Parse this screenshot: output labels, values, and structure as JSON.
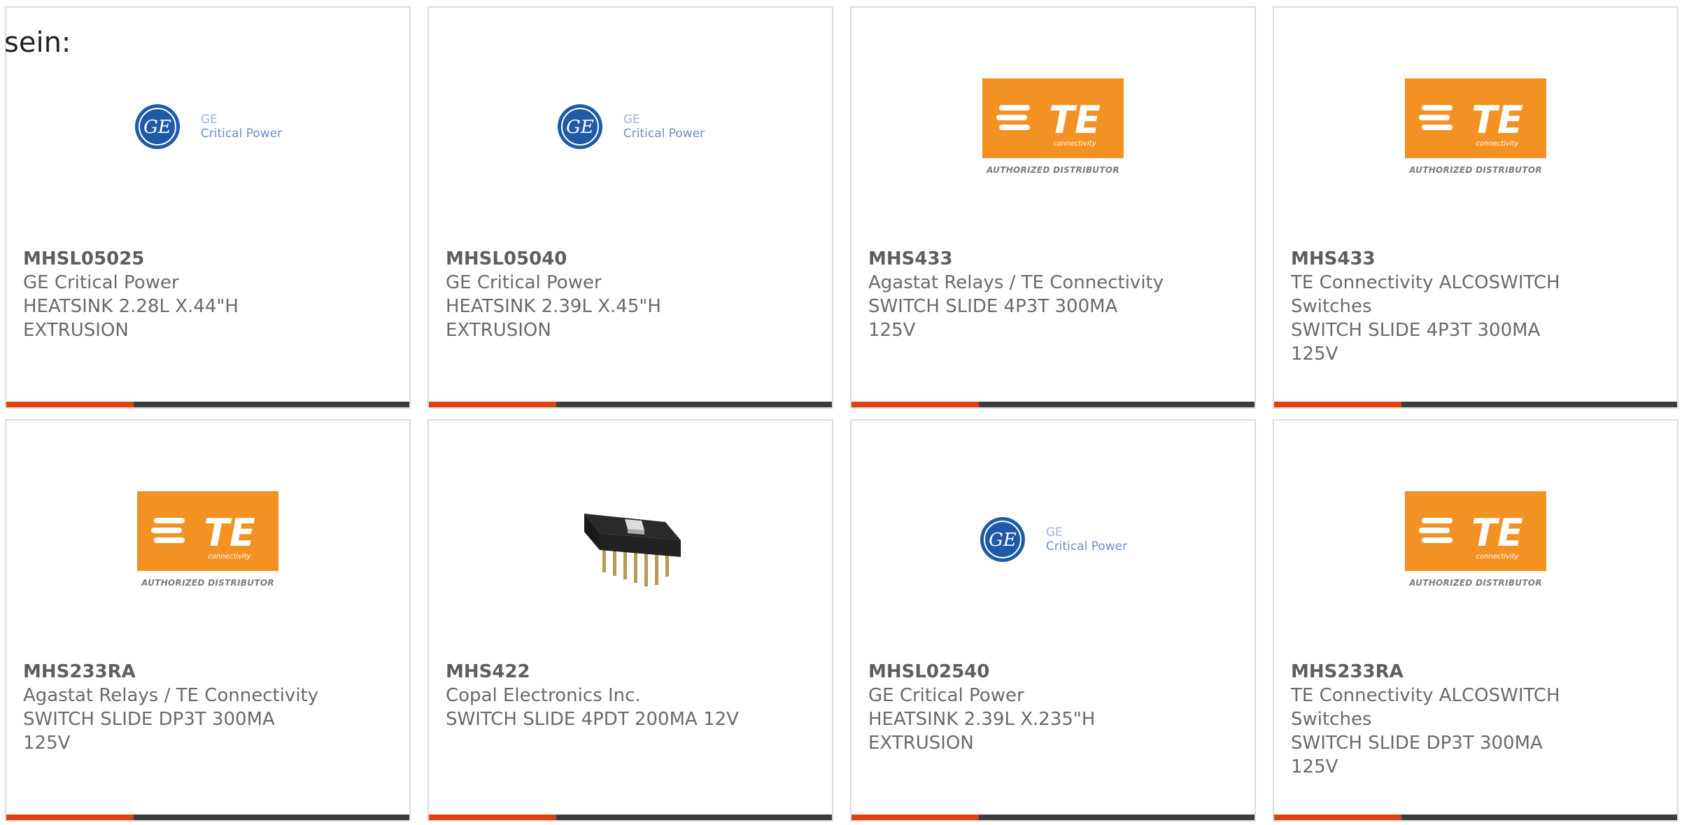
{
  "lead_text": "sein:",
  "colors": {
    "accent_bar": "#e0400d",
    "bar_base": "#3c3c3c",
    "card_border": "#dcdcdc",
    "te_orange": "#f39223",
    "ge_blue": "#1e5aa8"
  },
  "logos": {
    "ge": {
      "line1": "GE",
      "line2": "Critical Power"
    },
    "te": {
      "brand": "TE",
      "sub": "connectivity",
      "authorized": "AUTHORIZED DISTRIBUTOR"
    }
  },
  "cards": [
    {
      "part_number": "MHSL05025",
      "manufacturer": "GE Critical Power",
      "description": "HEATSINK 2.28L X.44\"H EXTRUSION",
      "logo": "ge-critical-power-logo"
    },
    {
      "part_number": "MHSL05040",
      "manufacturer": "GE Critical Power",
      "description": "HEATSINK 2.39L X.45\"H EXTRUSION",
      "logo": "ge-critical-power-logo"
    },
    {
      "part_number": "MHS433",
      "manufacturer": "Agastat Relays / TE Connectivity",
      "description": "SWITCH SLIDE 4P3T 300MA 125V",
      "logo": "te-connectivity-logo"
    },
    {
      "part_number": "MHS433",
      "manufacturer": "TE Connectivity ALCOSWITCH Switches",
      "description": "SWITCH SLIDE 4P3T 300MA 125V",
      "logo": "te-connectivity-logo"
    },
    {
      "part_number": "MHS233RA",
      "manufacturer": "Agastat Relays / TE Connectivity",
      "description": "SWITCH SLIDE DP3T 300MA 125V",
      "logo": "te-connectivity-logo"
    },
    {
      "part_number": "MHS422",
      "manufacturer": "Copal Electronics Inc.",
      "description": "SWITCH SLIDE 4PDT 200MA 12V",
      "logo": "slide-switch-product-image"
    },
    {
      "part_number": "MHSL02540",
      "manufacturer": "GE Critical Power",
      "description": "HEATSINK 2.39L X.235\"H EXTRUSION",
      "logo": "ge-critical-power-logo"
    },
    {
      "part_number": "MHS233RA",
      "manufacturer": "TE Connectivity ALCOSWITCH Switches",
      "description": "SWITCH SLIDE DP3T 300MA 125V",
      "logo": "te-connectivity-logo"
    }
  ]
}
